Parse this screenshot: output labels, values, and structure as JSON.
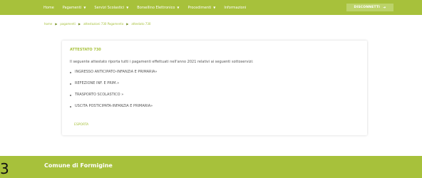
{
  "nav": {
    "items": [
      {
        "label": "Home",
        "dropdown": false
      },
      {
        "label": "Pagamenti",
        "dropdown": true
      },
      {
        "label": "Servizi Scolastici",
        "dropdown": true
      },
      {
        "label": "Borsellino Elettronico",
        "dropdown": true
      },
      {
        "label": "Procedimenti",
        "dropdown": true
      },
      {
        "label": "Informazioni",
        "dropdown": false
      }
    ],
    "disconnect_label": "DISCONNETTI",
    "disconnect_icon": "logout-icon"
  },
  "breadcrumb": [
    "home",
    "pagamenti",
    "attestazioni 730 Pagamento",
    "attestato 730"
  ],
  "card": {
    "title": "ATTESTATO 730",
    "description": "Il seguente attestato riporta tutti i pagamenti effettuati nell'anno 2021 relativi ai seguenti sottoservizi:",
    "services": [
      "INGRESSO ANTICIPATO-INFANZIA E PRIMARIA»",
      "REFEZIONE INF. E PRIM.»",
      "TRASPORTO SCOLASTICO »",
      "USCITA POSTICIPATA-INFANZIA E PRIMARIA»"
    ],
    "export_label": "ESPORTA"
  },
  "footer": {
    "title": "Comune di Formigine"
  },
  "edge_glyph": "3",
  "colors": {
    "brand": "#a7c13b",
    "text": "#555555"
  }
}
